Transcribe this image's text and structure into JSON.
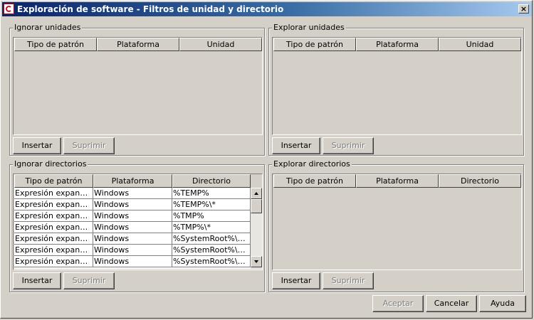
{
  "window": {
    "title": "Exploración de software - Filtros de unidad y directorio",
    "close_label": "×"
  },
  "ignore_drives": {
    "legend": "Ignorar unidades",
    "columns": [
      "Tipo de patrón",
      "Plataforma",
      "Unidad"
    ],
    "insert_label": "Insertar",
    "delete_label": "Suprimir"
  },
  "explore_drives": {
    "legend": "Explorar unidades",
    "columns": [
      "Tipo de patrón",
      "Plataforma",
      "Unidad"
    ],
    "insert_label": "Insertar",
    "delete_label": "Suprimir"
  },
  "ignore_dirs": {
    "legend": "Ignorar directorios",
    "columns": [
      "Tipo de patrón",
      "Plataforma",
      "Directorio"
    ],
    "rows": [
      [
        "Expresión expandibl...",
        "Windows",
        "%TEMP%"
      ],
      [
        "Expresión expandibl...",
        "Windows",
        "%TEMP%\\*"
      ],
      [
        "Expresión expandibl...",
        "Windows",
        "%TMP%"
      ],
      [
        "Expresión expandibl...",
        "Windows",
        "%TMP%\\*"
      ],
      [
        "Expresión expandibl...",
        "Windows",
        "%SystemRoot%\\Ser..."
      ],
      [
        "Expresión expandibl...",
        "Windows",
        "%SystemRoot%\\Ser..."
      ],
      [
        "Expresión expandibl...",
        "Windows",
        "%SystemRoot%\\$Nt..."
      ]
    ],
    "insert_label": "Insertar",
    "delete_label": "Suprimir"
  },
  "explore_dirs": {
    "legend": "Explorar directorios",
    "columns": [
      "Tipo de patrón",
      "Plataforma",
      "Directorio"
    ],
    "insert_label": "Insertar",
    "delete_label": "Suprimir"
  },
  "footer": {
    "accept_label": "Aceptar",
    "cancel_label": "Cancelar",
    "help_label": "Ayuda"
  }
}
